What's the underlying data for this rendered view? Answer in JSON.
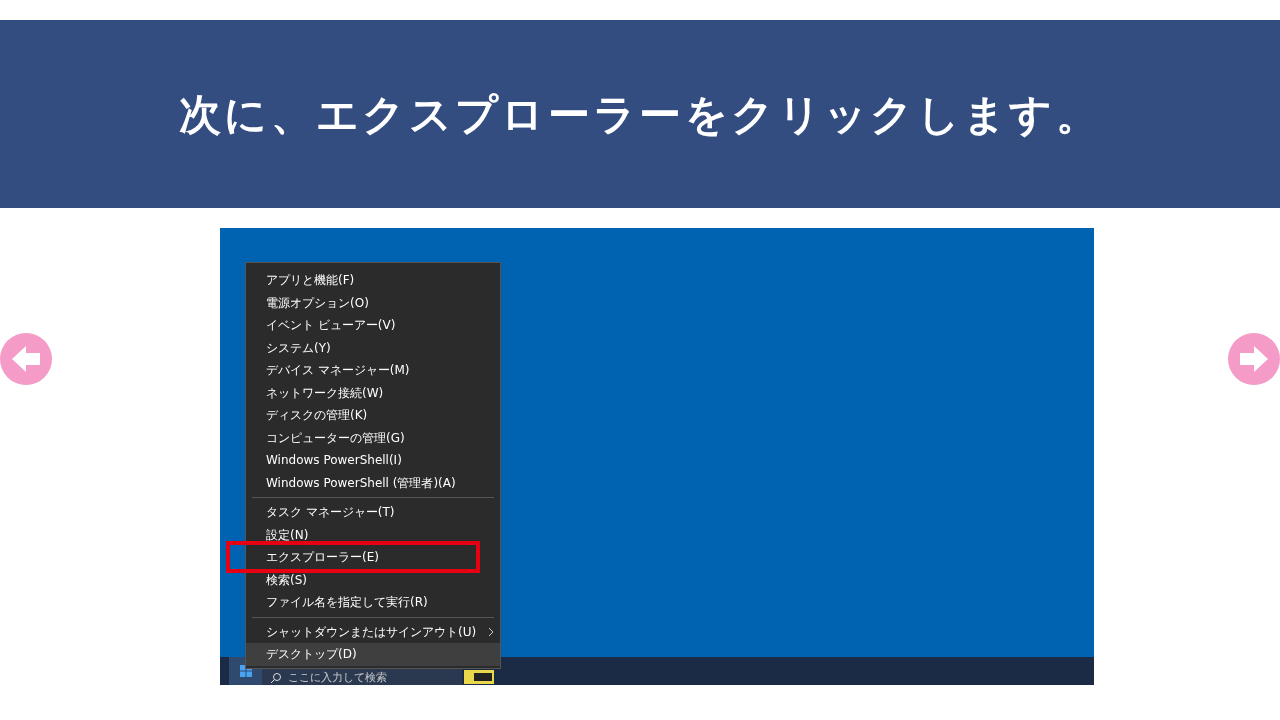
{
  "header": {
    "title": "次に、エクスプローラーをクリックします。"
  },
  "nav": {
    "previous": true,
    "next": true
  },
  "screenshot": {
    "menu": {
      "groups": [
        [
          {
            "label": "アプリと機能(F)",
            "selected": false,
            "highlighted": false,
            "submenu": false
          },
          {
            "label": "電源オプション(O)",
            "selected": false,
            "highlighted": false,
            "submenu": false
          },
          {
            "label": "イベント ビューアー(V)",
            "selected": false,
            "highlighted": false,
            "submenu": false
          },
          {
            "label": "システム(Y)",
            "selected": false,
            "highlighted": false,
            "submenu": false
          },
          {
            "label": "デバイス マネージャー(M)",
            "selected": false,
            "highlighted": false,
            "submenu": false
          },
          {
            "label": "ネットワーク接続(W)",
            "selected": false,
            "highlighted": false,
            "submenu": false
          },
          {
            "label": "ディスクの管理(K)",
            "selected": false,
            "highlighted": false,
            "submenu": false
          },
          {
            "label": "コンピューターの管理(G)",
            "selected": false,
            "highlighted": false,
            "submenu": false
          },
          {
            "label": "Windows PowerShell(I)",
            "selected": false,
            "highlighted": false,
            "submenu": false
          },
          {
            "label": "Windows PowerShell (管理者)(A)",
            "selected": false,
            "highlighted": false,
            "submenu": false
          }
        ],
        [
          {
            "label": "タスク マネージャー(T)",
            "selected": false,
            "highlighted": false,
            "submenu": false
          },
          {
            "label": "設定(N)",
            "selected": false,
            "highlighted": false,
            "submenu": false
          },
          {
            "label": "エクスプローラー(E)",
            "selected": false,
            "highlighted": true,
            "submenu": false
          },
          {
            "label": "検索(S)",
            "selected": false,
            "highlighted": false,
            "submenu": false
          },
          {
            "label": "ファイル名を指定して実行(R)",
            "selected": false,
            "highlighted": false,
            "submenu": false
          }
        ],
        [
          {
            "label": "シャットダウンまたはサインアウト(U)",
            "selected": false,
            "highlighted": false,
            "submenu": true
          },
          {
            "label": "デスクトップ(D)",
            "selected": true,
            "highlighted": false,
            "submenu": false
          }
        ]
      ]
    },
    "taskbar": {
      "search_placeholder": "ここに入力して検索"
    }
  }
}
